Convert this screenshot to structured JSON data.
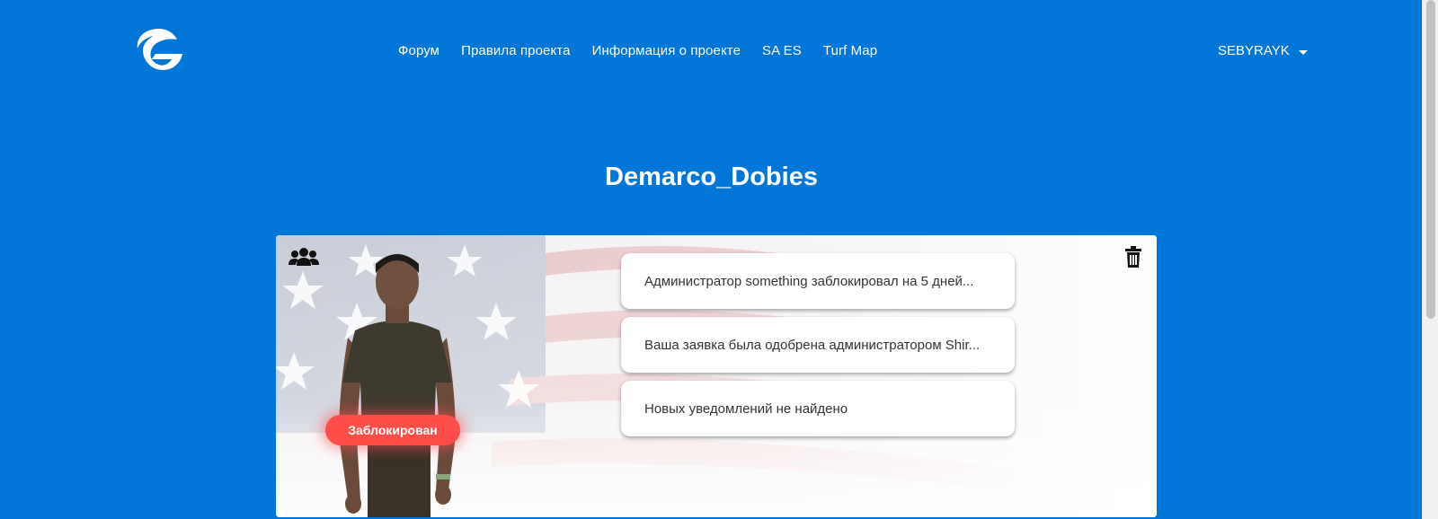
{
  "header": {
    "logo_icon": "project-logo-g-icon",
    "nav": [
      {
        "label": "Форум"
      },
      {
        "label": "Правила проекта"
      },
      {
        "label": "Информация о проекте"
      },
      {
        "label": "SA ES"
      },
      {
        "label": "Turf Map"
      }
    ],
    "user": {
      "name": "SEBYRAYK",
      "dropdown_icon": "caret-down-icon"
    }
  },
  "profile": {
    "title": "Demarco_Dobies",
    "status": "Заблокирован",
    "status_color": "#ff4d4a",
    "group_icon": "users-icon",
    "delete_icon": "trash-icon",
    "notifications": [
      {
        "text": "Администратор something заблокировал на 5 дней..."
      },
      {
        "text": "Ваша заявка была одобрена администратором Shir..."
      },
      {
        "text": "Новых уведомлений не найдено"
      }
    ]
  },
  "colors": {
    "background": "#0176d9",
    "text": "#ffffff"
  }
}
